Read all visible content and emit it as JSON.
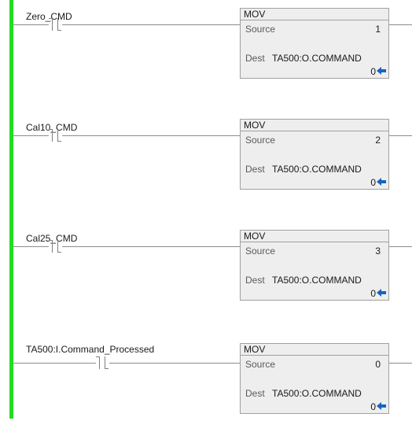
{
  "rungs": [
    {
      "contact_tag": "Zero_CMD",
      "instruction": "MOV",
      "source_label": "Source",
      "source_value": "1",
      "dest_label": "Dest",
      "dest_tag": "TA500:O.COMMAND",
      "dest_value": "0"
    },
    {
      "contact_tag": "Cal10_CMD",
      "instruction": "MOV",
      "source_label": "Source",
      "source_value": "2",
      "dest_label": "Dest",
      "dest_tag": "TA500:O.COMMAND",
      "dest_value": "0"
    },
    {
      "contact_tag": "Cal25_CMD",
      "instruction": "MOV",
      "source_label": "Source",
      "source_value": "3",
      "dest_label": "Dest",
      "dest_tag": "TA500:O.COMMAND",
      "dest_value": "0"
    },
    {
      "contact_tag": "TA500:I.Command_Processed",
      "instruction": "MOV",
      "source_label": "Source",
      "source_value": "0",
      "dest_label": "Dest",
      "dest_tag": "TA500:O.COMMAND",
      "dest_value": "0"
    }
  ],
  "colors": {
    "power_rail": "#22dd22",
    "arrow": "#1565c0",
    "instruction_bg": "#eeeeee"
  },
  "icons": {
    "contact": "xic-contact-icon",
    "dest_arrow": "arrow-left-icon"
  }
}
